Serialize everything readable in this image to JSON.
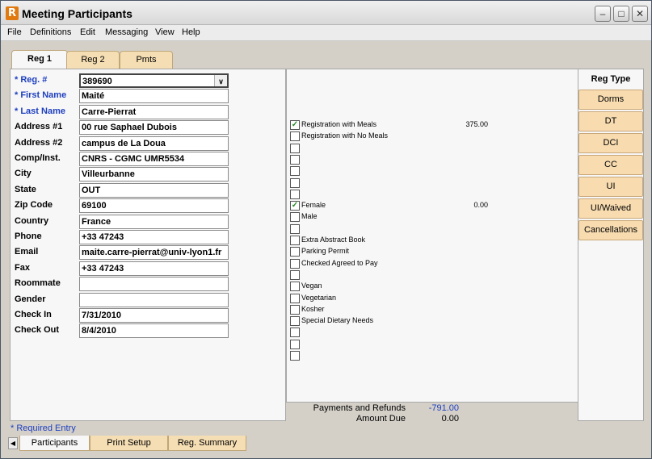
{
  "window": {
    "title": "Meeting Participants"
  },
  "menu": [
    "File",
    "Definitions",
    "Edit",
    "Messaging",
    "View",
    "Help"
  ],
  "tabs": [
    "Reg 1",
    "Reg 2",
    "Pmts"
  ],
  "fields": [
    {
      "label": "* Reg. #",
      "value": "389690",
      "required": true,
      "dropdown": true
    },
    {
      "label": "* First Name",
      "value": "Maité",
      "required": true
    },
    {
      "label": "* Last Name",
      "value": "Carre-Pierrat",
      "required": true
    },
    {
      "label": "Address #1",
      "value": "00 rue Saphael Dubois"
    },
    {
      "label": "Address #2",
      "value": "campus de La Doua"
    },
    {
      "label": "Comp/Inst.",
      "value": "CNRS - CGMC UMR5534"
    },
    {
      "label": "City",
      "value": "Villeurbanne"
    },
    {
      "label": "State",
      "value": "OUT"
    },
    {
      "label": "Zip Code",
      "value": "69100"
    },
    {
      "label": "Country",
      "value": "France"
    },
    {
      "label": "Phone",
      "value": "+33 47243"
    },
    {
      "label": "Email",
      "value": "maite.carre-pierrat@univ-lyon1.fr"
    },
    {
      "label": "Fax",
      "value": "+33 47243"
    },
    {
      "label": "Roommate",
      "value": ""
    },
    {
      "label": "Gender",
      "value": ""
    },
    {
      "label": "Check In",
      "value": "7/31/2010"
    },
    {
      "label": "Check Out",
      "value": "8/4/2010"
    }
  ],
  "options": [
    {
      "label": "Registration with Meals",
      "checked": true,
      "amount": "375.00"
    },
    {
      "label": "Registration with No Meals",
      "checked": false,
      "amount": ""
    },
    {
      "label": "",
      "checked": false,
      "amount": ""
    },
    {
      "label": "",
      "checked": false,
      "amount": ""
    },
    {
      "label": "",
      "checked": false,
      "amount": ""
    },
    {
      "label": "",
      "checked": false,
      "amount": ""
    },
    {
      "label": "",
      "checked": false,
      "amount": ""
    },
    {
      "label": "Female",
      "checked": true,
      "amount": "0.00"
    },
    {
      "label": "Male",
      "checked": false,
      "amount": ""
    },
    {
      "label": "",
      "checked": false,
      "amount": ""
    },
    {
      "label": "Extra Abstract Book",
      "checked": false,
      "amount": ""
    },
    {
      "label": "Parking Permit",
      "checked": false,
      "amount": ""
    },
    {
      "label": "Checked Agreed to Pay",
      "checked": false,
      "amount": ""
    },
    {
      "label": "",
      "checked": false,
      "amount": ""
    },
    {
      "label": "Vegan",
      "checked": false,
      "amount": ""
    },
    {
      "label": "Vegetarian",
      "checked": false,
      "amount": ""
    },
    {
      "label": "Kosher",
      "checked": false,
      "amount": ""
    },
    {
      "label": "Special Dietary Needs",
      "checked": false,
      "amount": ""
    },
    {
      "label": "",
      "checked": false,
      "amount": ""
    },
    {
      "label": "",
      "checked": false,
      "amount": ""
    },
    {
      "label": "",
      "checked": false,
      "amount": ""
    }
  ],
  "reg_type": {
    "title": "Reg Type",
    "buttons": [
      "Dorms",
      "DT",
      "DCI",
      "CC",
      "UI",
      "UI/Waived",
      "Cancellations"
    ]
  },
  "totals": {
    "payments_label": "Payments and Refunds",
    "payments_value": "-791.00",
    "due_label": "Amount Due",
    "due_value": "0.00"
  },
  "required_note": "* Required Entry",
  "bottom_tabs": [
    "Participants",
    "Print Setup",
    "Reg. Summary"
  ],
  "colors": {
    "required_label": "#1e3fbf",
    "tab_fill": "#f5deb3",
    "check": "#2a8a2a"
  }
}
